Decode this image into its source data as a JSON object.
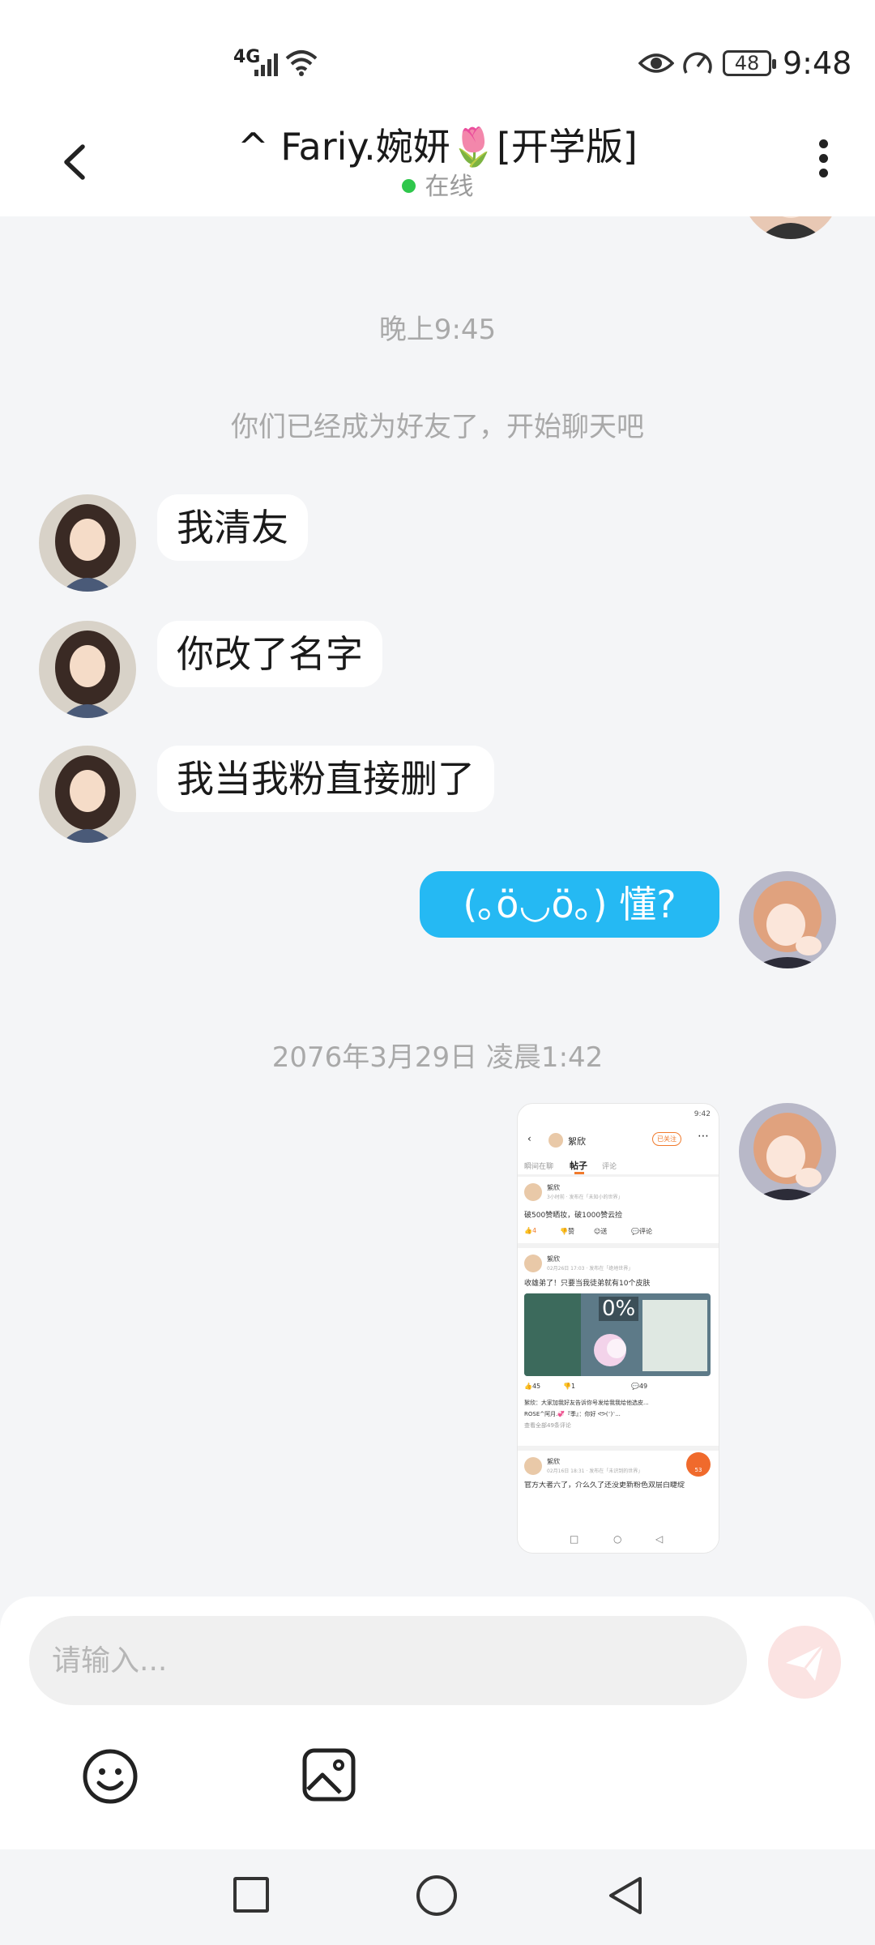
{
  "status_bar": {
    "network": "4G",
    "battery": "48",
    "time": "9:48"
  },
  "header": {
    "title": "^ Fariy.婉妍🌷[开学版]",
    "status": "在线"
  },
  "messages": {
    "time_1": "晚上9:45",
    "system_notice": "你们已经成为好友了，开始聊天吧",
    "in_1": "我清友",
    "in_2": "你改了名字",
    "in_3": "我当我粉直接删了",
    "out_1": "(｡ö◡ö｡) 懂?",
    "time_2": "2076年3月29日 凌晨1:42"
  },
  "shared_screenshot": {
    "time": "9:42",
    "user": "絮欣",
    "follow": "已关注",
    "tabs": [
      "瞬间在聊",
      "帖子",
      "评论"
    ],
    "post1": {
      "name": "絮欣",
      "meta": "3小时前 · 发布在「未知小的世界」",
      "text": "破500赞晒妆，破1000赞云捡",
      "likes": "4",
      "action1": "赞",
      "action2": "送",
      "action3": "评论"
    },
    "post2": {
      "name": "絮欣",
      "meta": "02月26日 17:03 · 发布在「绝地世界」",
      "text": "收雄弟了！只要当我徒弟就有10个皮肤",
      "progress": "0%",
      "likes": "45",
      "dislikes": "1",
      "comments": "49",
      "reply1": "絮欣：大家加我好友告诉你号发给我我给他选皮...",
      "reply2": "ROSE^阿月.💞『季』：你好 ᕙᕗ(ᵔ)ᵔ...",
      "see_all": "查看全部49条评论"
    },
    "post3": {
      "name": "絮欣",
      "meta": "02月16日 18:31 · 发布在「未识到的世界」",
      "text": "官方大者六了，介么久了还没更新粉色双层白睫绽",
      "badge": "53"
    }
  },
  "input": {
    "placeholder": "请输入..."
  },
  "colors": {
    "out_bubble": "#25b9f3",
    "online_dot": "#2fc74c",
    "send_bg": "#fbe3e2"
  }
}
